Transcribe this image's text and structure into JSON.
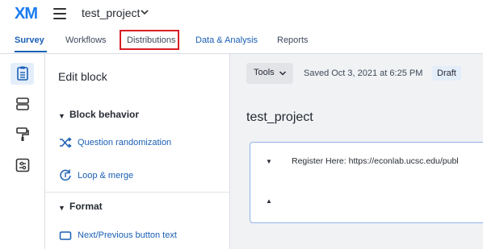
{
  "header": {
    "logo": "XM",
    "project_name": "test_project"
  },
  "tabs": [
    {
      "label": "Survey",
      "active": true
    },
    {
      "label": "Workflows",
      "active": false
    },
    {
      "label": "Distributions",
      "active": false,
      "highlighted": true
    },
    {
      "label": "Data & Analysis",
      "active": false
    },
    {
      "label": "Reports",
      "active": false
    }
  ],
  "rail": {
    "icons": [
      "survey-flow-icon",
      "blocks-icon",
      "paint-roller-icon",
      "settings-sliders-icon"
    ]
  },
  "panel": {
    "title": "Edit block",
    "sections": [
      {
        "title": "Block behavior",
        "options": [
          {
            "label": "Question randomization",
            "icon": "shuffle-icon"
          },
          {
            "label": "Loop & merge",
            "icon": "loop-icon"
          }
        ]
      },
      {
        "title": "Format",
        "options": [
          {
            "label": "Next/Previous button text",
            "icon": "button-text-icon"
          }
        ]
      }
    ]
  },
  "toolbar": {
    "tools_label": "Tools",
    "saved_text": "Saved Oct 3, 2021 at 6:25 PM",
    "status_badge": "Draft"
  },
  "survey": {
    "title": "test_project",
    "question_text": "Register Here: https://econlab.ucsc.edu/publ"
  },
  "colors": {
    "accent": "#1a5fb4",
    "logo": "#1a7cf0",
    "highlight_box": "#d81e26",
    "badge_bg": "#e4eefb"
  }
}
